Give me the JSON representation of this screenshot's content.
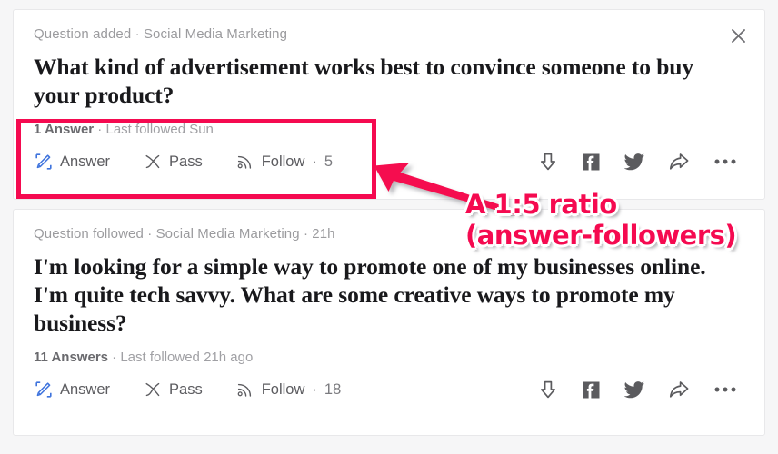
{
  "theme": {
    "accent_pink": "#f50a50",
    "card_bg": "#ffffff",
    "page_bg": "#f6f6f7",
    "answer_icon_blue": "#3e73dd",
    "muted_text": "#9b9b9e"
  },
  "cards": [
    {
      "meta": "Question added · Social Media Marketing",
      "title": "What kind of advertisement works best to convince someone to buy your product?",
      "stats": {
        "count": "1 Answer",
        "separator": " · ",
        "detail": "Last followed Sun"
      },
      "actions": {
        "answer_label": "Answer",
        "pass_label": "Pass",
        "follow_label": "Follow",
        "follow_sep": " · ",
        "follow_count": "5"
      },
      "icons": {
        "answer": "pencil-edit-icon",
        "pass": "pass-cross-icon",
        "follow": "rss-signal-icon",
        "downvote": "downvote-arrow-icon",
        "facebook": "facebook-icon",
        "twitter": "twitter-bird-icon",
        "share": "share-arrow-icon",
        "more": "more-dots-icon",
        "close": "close-icon"
      }
    },
    {
      "meta": "Question followed · Social Media Marketing · 21h",
      "title": "I'm looking for a simple way to promote one of my businesses online. I'm quite tech savvy. What are some creative ways to promote my business?",
      "stats": {
        "count": "11 Answers",
        "separator": " · ",
        "detail": "Last followed 21h ago"
      },
      "actions": {
        "answer_label": "Answer",
        "pass_label": "Pass",
        "follow_label": "Follow",
        "follow_sep": " · ",
        "follow_count": "18"
      },
      "icons": {
        "answer": "pencil-edit-icon",
        "pass": "pass-cross-icon",
        "follow": "rss-signal-icon",
        "downvote": "downvote-arrow-icon",
        "facebook": "facebook-icon",
        "twitter": "twitter-bird-icon",
        "share": "share-arrow-icon",
        "more": "more-dots-icon"
      }
    }
  ],
  "annotation": {
    "line1": "A 1:5 ratio",
    "line2": "(answer-followers)",
    "color": "#f50a50",
    "arrow": "annotation-arrow-icon",
    "highlight": "annotation-highlight-box"
  }
}
